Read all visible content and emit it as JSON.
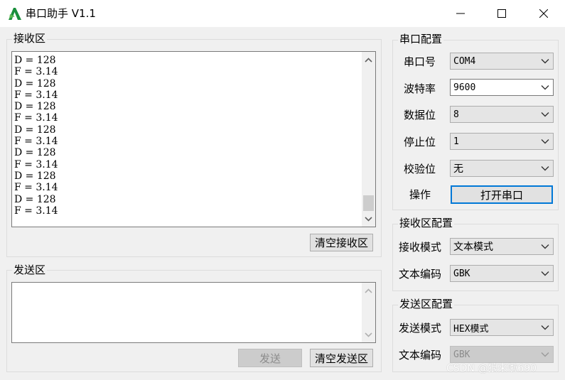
{
  "window": {
    "title": "串口助手 V1.1",
    "minimize_glyph": "—",
    "maximize_glyph": "☐",
    "close_glyph": "✕"
  },
  "receive_area": {
    "title": "接收区",
    "lines": [
      "D = 128",
      "F = 3.14",
      "D = 128",
      "F = 3.14",
      "D = 128",
      "F = 3.14",
      "D = 128",
      "F = 3.14",
      "D = 128",
      "F = 3.14",
      "D = 128",
      "F = 3.14",
      "D = 128",
      "F = 3.14"
    ],
    "clear_button": "清空接收区"
  },
  "send_area": {
    "title": "发送区",
    "text": "",
    "send_button": "发送",
    "clear_button": "清空发送区"
  },
  "serial_config": {
    "title": "串口配置",
    "port_label": "串口号",
    "port_value": "COM4",
    "baud_label": "波特率",
    "baud_value": "9600",
    "databits_label": "数据位",
    "databits_value": "8",
    "stopbits_label": "停止位",
    "stopbits_value": "1",
    "parity_label": "校验位",
    "parity_value": "无",
    "operation_label": "操作",
    "open_button": "打开串口"
  },
  "receive_config": {
    "title": "接收区配置",
    "mode_label": "接收模式",
    "mode_value": "文本模式",
    "encoding_label": "文本编码",
    "encoding_value": "GBK"
  },
  "send_config": {
    "title": "发送区配置",
    "mode_label": "发送模式",
    "mode_value": "HEX模式",
    "encoding_label": "文本编码",
    "encoding_value": "GBK"
  },
  "watermark": "CSDN @狼来啦690",
  "colors": {
    "accent": "#0078d7",
    "icon_green": "#1a8f3c",
    "window_bg": "#f0f0f0"
  }
}
